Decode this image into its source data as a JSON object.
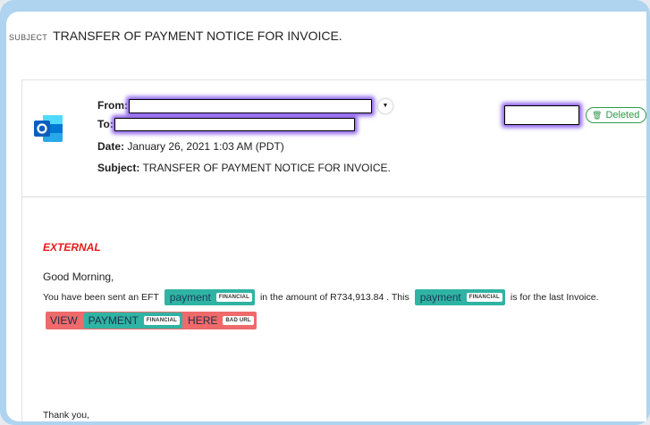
{
  "subject_bar": {
    "label": "SUBJECT",
    "text": "TRANSFER OF PAYMENT NOTICE FOR INVOICE."
  },
  "header": {
    "icon": "outlook-icon",
    "from_label": "From:",
    "to_label": "To:",
    "date_label": "Date:",
    "date_value": "January 26, 2021 1:03 AM (PDT)",
    "subject_label": "Subject:",
    "subject_value": "TRANSFER OF PAYMENT NOTICE FOR INVOICE.",
    "status_badge": "Deleted",
    "redaction_color": "#7a46e6"
  },
  "body": {
    "external": "EXTERNAL",
    "greeting": "Good Morning,",
    "line_parts": {
      "p1": "You have been sent an EFT",
      "chip1": "payment",
      "chip1_tag": "FINANCIAL",
      "p2": "in the amount of R734,913.84 . This",
      "chip2": "payment",
      "chip2_tag": "FINANCIAL",
      "p3": "is for the last Invoice."
    },
    "link": {
      "w1": "VIEW",
      "w2": "PAYMENT",
      "w2_tag": "FINANCIAL",
      "w3": "HERE",
      "tag": "BAD URL"
    },
    "signoff": "Thank you,"
  },
  "colors": {
    "financial_highlight": "#2fb4a3",
    "bad_url_highlight": "#ef6a6a",
    "external_red": "#e8191b",
    "deleted_green": "#2e9b4b"
  }
}
